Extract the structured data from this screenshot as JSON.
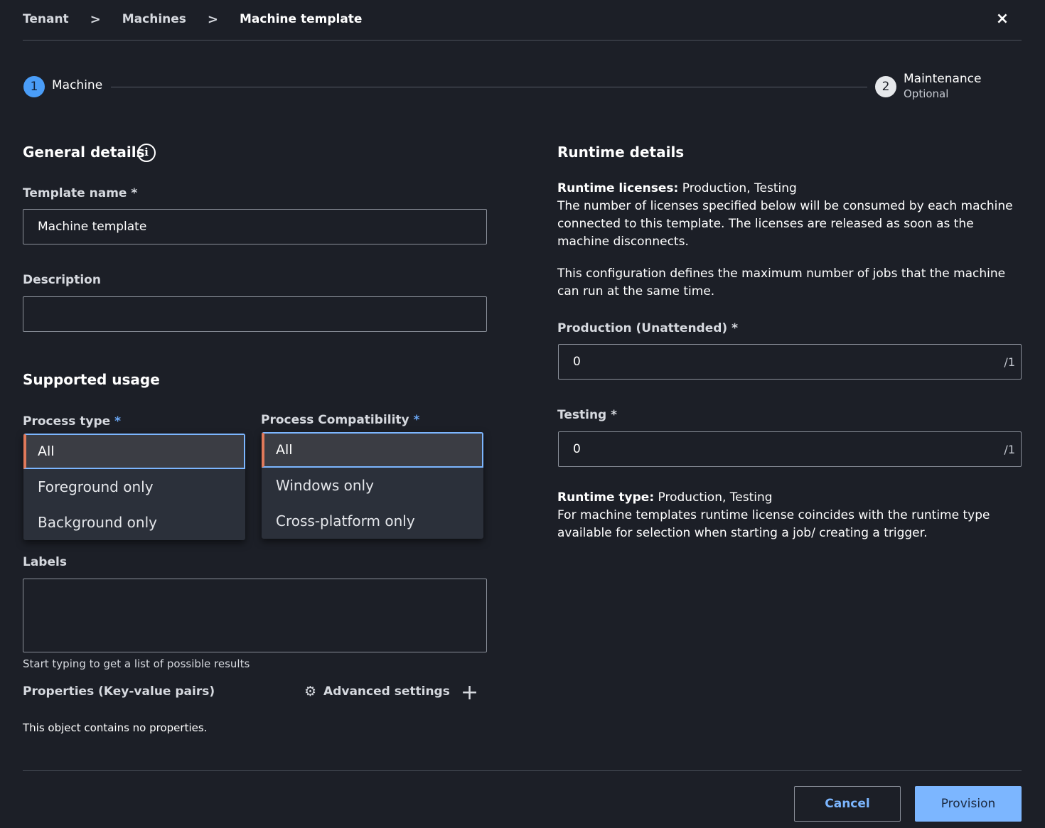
{
  "breadcrumb": {
    "items": [
      "Tenant",
      "Machines",
      "Machine template"
    ],
    "separator": ">"
  },
  "close_icon": "×",
  "stepper": {
    "steps": [
      {
        "number": "1",
        "label": "Machine",
        "sublabel": ""
      },
      {
        "number": "2",
        "label": "Maintenance",
        "sublabel": "Optional"
      }
    ]
  },
  "general": {
    "title": "General details",
    "info_glyph": "i",
    "template_name": {
      "label": "Template name *",
      "value": "Machine template"
    },
    "description": {
      "label": "Description",
      "value": ""
    }
  },
  "usage": {
    "title": "Supported usage",
    "process_type": {
      "label": "Process type",
      "required": "*",
      "selected": "All",
      "options": [
        "Foreground only",
        "Background only"
      ]
    },
    "process_compat": {
      "label": "Process Compatibility",
      "required": "*",
      "selected": "All",
      "options": [
        "Windows only",
        "Cross-platform only"
      ]
    }
  },
  "labels": {
    "label": "Labels",
    "hint": "Start typing to get a list of possible results"
  },
  "properties": {
    "label": "Properties (Key-value pairs)",
    "advanced": "Advanced settings",
    "add_glyph": "+",
    "empty": "This object contains no properties."
  },
  "runtime": {
    "title": "Runtime details",
    "licenses_label": "Runtime licenses:",
    "licenses_value": "Production, Testing",
    "licenses_desc": "The number of licenses specified below will be consumed by each machine connected to this template. The licenses are released as soon as the machine disconnects.",
    "config_desc": "This configuration defines the maximum number of jobs that the machine can run at the same time.",
    "production": {
      "label": "Production (Unattended) *",
      "value": "0",
      "suffix": "/1"
    },
    "testing": {
      "label": "Testing *",
      "value": "0",
      "suffix": "/1"
    },
    "type_label": "Runtime type:",
    "type_value": "Production, Testing",
    "type_desc": "For machine templates runtime license coincides with the runtime type available for selection when starting a job/ creating a trigger."
  },
  "footer": {
    "cancel": "Cancel",
    "provision": "Provision"
  },
  "colors": {
    "background": "#1c1f27",
    "accent": "#7cb6ff",
    "step_active": "#4a9df8"
  },
  "icons": {
    "close": "close-icon",
    "info": "info-icon",
    "gear": "gear-icon",
    "plus": "plus-icon",
    "chevron": "chevron-right-icon"
  }
}
